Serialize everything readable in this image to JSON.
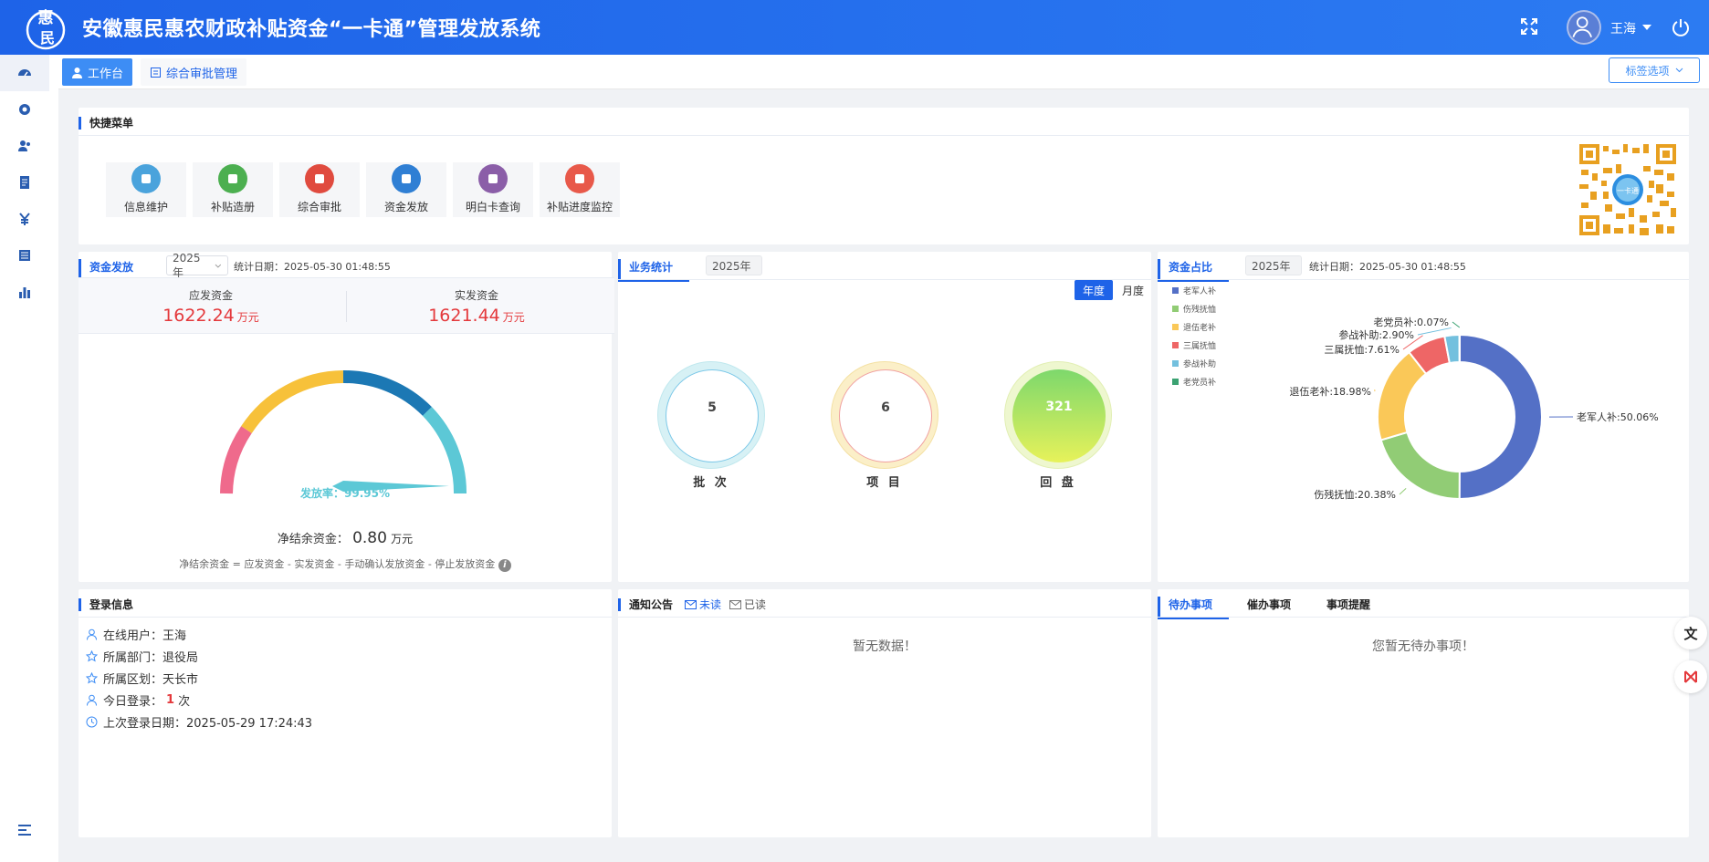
{
  "header": {
    "title": "安徽惠民惠农财政补贴资金“一卡通”管理发放系统",
    "logo_text": "惠民",
    "user": "王海"
  },
  "sidebar": {
    "items": [
      "dashboard-icon",
      "gear-icon",
      "users-icon",
      "document-icon",
      "yuan-icon",
      "list-icon",
      "bar-chart-icon"
    ],
    "collapse": "collapse-icon"
  },
  "tabs": [
    {
      "label": "工作台"
    },
    {
      "label": "综合审批管理"
    }
  ],
  "tag_options": "标签选项",
  "quick_menu": {
    "title": "快捷菜单",
    "items": [
      {
        "label": "信息维护",
        "icon": "id-card-icon",
        "color": "#4aa3dc"
      },
      {
        "label": "补贴造册",
        "icon": "books-icon",
        "color": "#4caf50"
      },
      {
        "label": "综合审批",
        "icon": "stamp-icon",
        "color": "#e04b3f"
      },
      {
        "label": "资金发放",
        "icon": "money-icon",
        "color": "#2f7fd4"
      },
      {
        "label": "明白卡查询",
        "icon": "search-card-icon",
        "color": "#8b5ea8"
      },
      {
        "label": "补贴进度监控",
        "icon": "monitor-icon",
        "color": "#e8594a"
      }
    ]
  },
  "fund_issue": {
    "title": "资金发放",
    "year": "2025年",
    "stat_date": "统计日期：2025-05-30 01:48:55",
    "due_label": "应发资金",
    "due_value": "1622.24",
    "due_unit": "万元",
    "paid_label": "实发资金",
    "paid_value": "1621.44",
    "paid_unit": "万元",
    "rate_label": "发放率：99.95%",
    "rate": 0.9995,
    "net_label": "净结余资金：",
    "net_value": "0.80",
    "net_unit": "万元",
    "formula": "净结余资金 = 应发资金 - 实发资金 - 手动确认发放资金 - 停止发放资金"
  },
  "business_stats": {
    "title": "业务统计",
    "year": "2025年",
    "toggle_year": "年度",
    "toggle_month": "月度",
    "items": [
      {
        "label": "批 次",
        "value": "5"
      },
      {
        "label": "项 目",
        "value": "6"
      },
      {
        "label": "回 盘",
        "value": "321"
      }
    ]
  },
  "fund_ratio": {
    "title": "资金占比",
    "year": "2025年",
    "stat_date": "统计日期：2025-05-30 01:48:55"
  },
  "chart_data": {
    "type": "pie",
    "categories": [
      "老军人补",
      "伤残抚恤",
      "退伍老补",
      "三属抚恤",
      "参战补助",
      "老党员补"
    ],
    "values": [
      50.06,
      20.38,
      18.98,
      7.61,
      2.9,
      0.07
    ],
    "labels": [
      "老军人补:50.06%",
      "伤残抚恤:20.38%",
      "退伍老补:18.98%",
      "三属抚恤:7.61%",
      "参战补助:2.90%",
      "老党员补:0.07%"
    ],
    "colors": [
      "#5470c6",
      "#91cc75",
      "#fac858",
      "#ee6666",
      "#73c0de",
      "#3ba272"
    ],
    "legend_position": "left"
  },
  "login_info": {
    "title": "登录信息",
    "online_user": "在线用户：王海",
    "dept": "所属部门：退役局",
    "region": "所属区划：天长市",
    "today_prefix": "今日登录：",
    "today_count": "1",
    "today_suffix": "次",
    "last_login": "上次登录日期：2025-05-29 17:24:43"
  },
  "notice": {
    "title": "通知公告",
    "unread": "未读",
    "read": "已读",
    "empty": "暂无数据！"
  },
  "todo": {
    "tabs": [
      "待办事项",
      "催办事项",
      "事项提醒"
    ],
    "empty": "您暂无待办事项！"
  }
}
